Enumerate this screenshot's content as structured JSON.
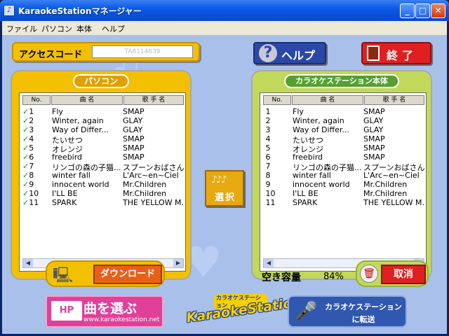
{
  "window": {
    "title": "KaraokeStationマネージャー",
    "minimize": "_",
    "maximize": "□",
    "close": "✕"
  },
  "menu": [
    "ファイル",
    "パソコン",
    "本体",
    "ヘルプ"
  ],
  "access_code": {
    "label": "アクセスコード",
    "value": "TA8114639"
  },
  "help_label": "ヘルプ",
  "exit_label": "終了",
  "columns": {
    "no": "No.",
    "song": "曲 名",
    "artist": "歌 手 名"
  },
  "pc_panel": {
    "title": "パソコン",
    "rows": [
      {
        "no": "1",
        "song": "Fly",
        "artist": "SMAP",
        "checked": true
      },
      {
        "no": "2",
        "song": "Winter, again",
        "artist": "GLAY",
        "checked": true
      },
      {
        "no": "3",
        "song": "Way of Differ...",
        "artist": "GLAY",
        "checked": true
      },
      {
        "no": "4",
        "song": "たいせつ",
        "artist": "SMAP",
        "checked": true
      },
      {
        "no": "5",
        "song": "オレンジ",
        "artist": "SMAP",
        "checked": true
      },
      {
        "no": "6",
        "song": "freebird",
        "artist": "SMAP",
        "checked": true
      },
      {
        "no": "7",
        "song": "リンゴの森の子猫...",
        "artist": "スプーンおばさん",
        "checked": true
      },
      {
        "no": "8",
        "song": "winter fall",
        "artist": "L'Arc~en~Ciel",
        "checked": true
      },
      {
        "no": "9",
        "song": "innocent world",
        "artist": "Mr.Children",
        "checked": true
      },
      {
        "no": "10",
        "song": "I'LL BE",
        "artist": "Mr.Children",
        "checked": true
      },
      {
        "no": "11",
        "song": "SPARK",
        "artist": "THE YELLOW M...",
        "checked": true
      }
    ],
    "download_label": "ダウンロード"
  },
  "station_panel": {
    "title": "カラオケステーション本体",
    "rows": [
      {
        "no": "1",
        "song": "Fly",
        "artist": "SMAP"
      },
      {
        "no": "2",
        "song": "Winter, again",
        "artist": "GLAY"
      },
      {
        "no": "3",
        "song": "Way of Differ...",
        "artist": "GLAY"
      },
      {
        "no": "4",
        "song": "たいせつ",
        "artist": "SMAP"
      },
      {
        "no": "5",
        "song": "オレンジ",
        "artist": "SMAP"
      },
      {
        "no": "6",
        "song": "freebird",
        "artist": "SMAP"
      },
      {
        "no": "7",
        "song": "リンゴの森の子猫...",
        "artist": "スプーンおばさん"
      },
      {
        "no": "8",
        "song": "winter fall",
        "artist": "L'Arc~en~Ciel"
      },
      {
        "no": "9",
        "song": "innocent world",
        "artist": "Mr.Children"
      },
      {
        "no": "10",
        "song": "I'LL BE",
        "artist": "Mr.Children"
      },
      {
        "no": "11",
        "song": "SPARK",
        "artist": "THE YELLOW M..."
      }
    ],
    "free_space_label": "空き容量",
    "free_space_value": "84",
    "free_space_unit": "%",
    "cancel_label": "取消"
  },
  "select_label": "選択",
  "select_icon": "♪♪♪",
  "hp_button": {
    "icon_text": "HP",
    "title": "曲を選ぶ",
    "url": "www.karaokestation.net"
  },
  "logo": {
    "main": "KaraokeStation",
    "sub": "カラオケステーション"
  },
  "transfer_button": {
    "line1": "カラオケステーション",
    "line2": "に転送"
  },
  "colors": {
    "pc_panel": "#f2c000",
    "station_panel": "#c2d85a",
    "background": "#a9c0ea",
    "accent_red": "#e02020"
  }
}
